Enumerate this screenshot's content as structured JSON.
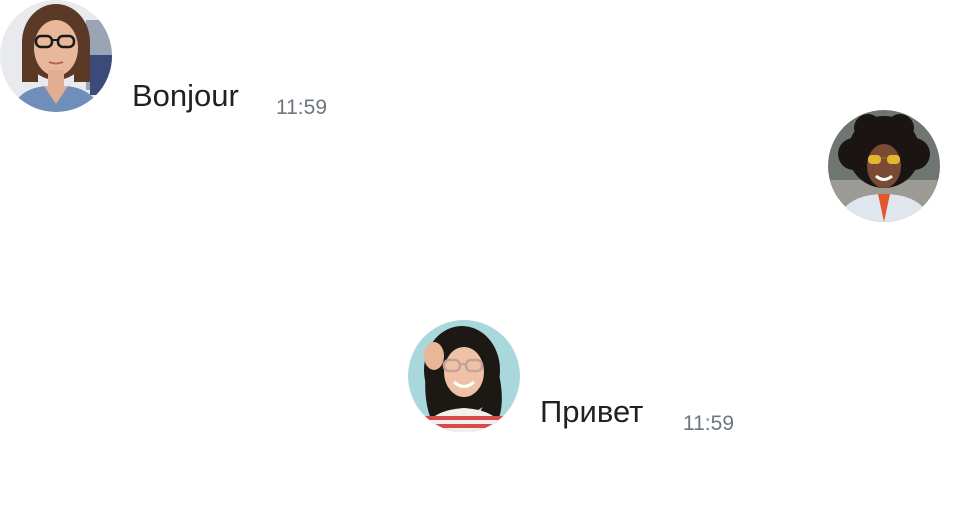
{
  "messages": [
    {
      "avatar": "user-photo-avatar-glasses-brown-hair",
      "text": "Bonjour",
      "time": "11:59"
    },
    {
      "avatar": "user-photo-avatar-curly-hair-yellow-sunglasses",
      "text": "",
      "time": ""
    },
    {
      "avatar": "user-photo-avatar-long-dark-hair-smiling",
      "text": "Привет",
      "time": "11:59"
    }
  ],
  "colors": {
    "text": "#1f2124",
    "timestamp": "#6b7680",
    "background": "#ffffff"
  }
}
